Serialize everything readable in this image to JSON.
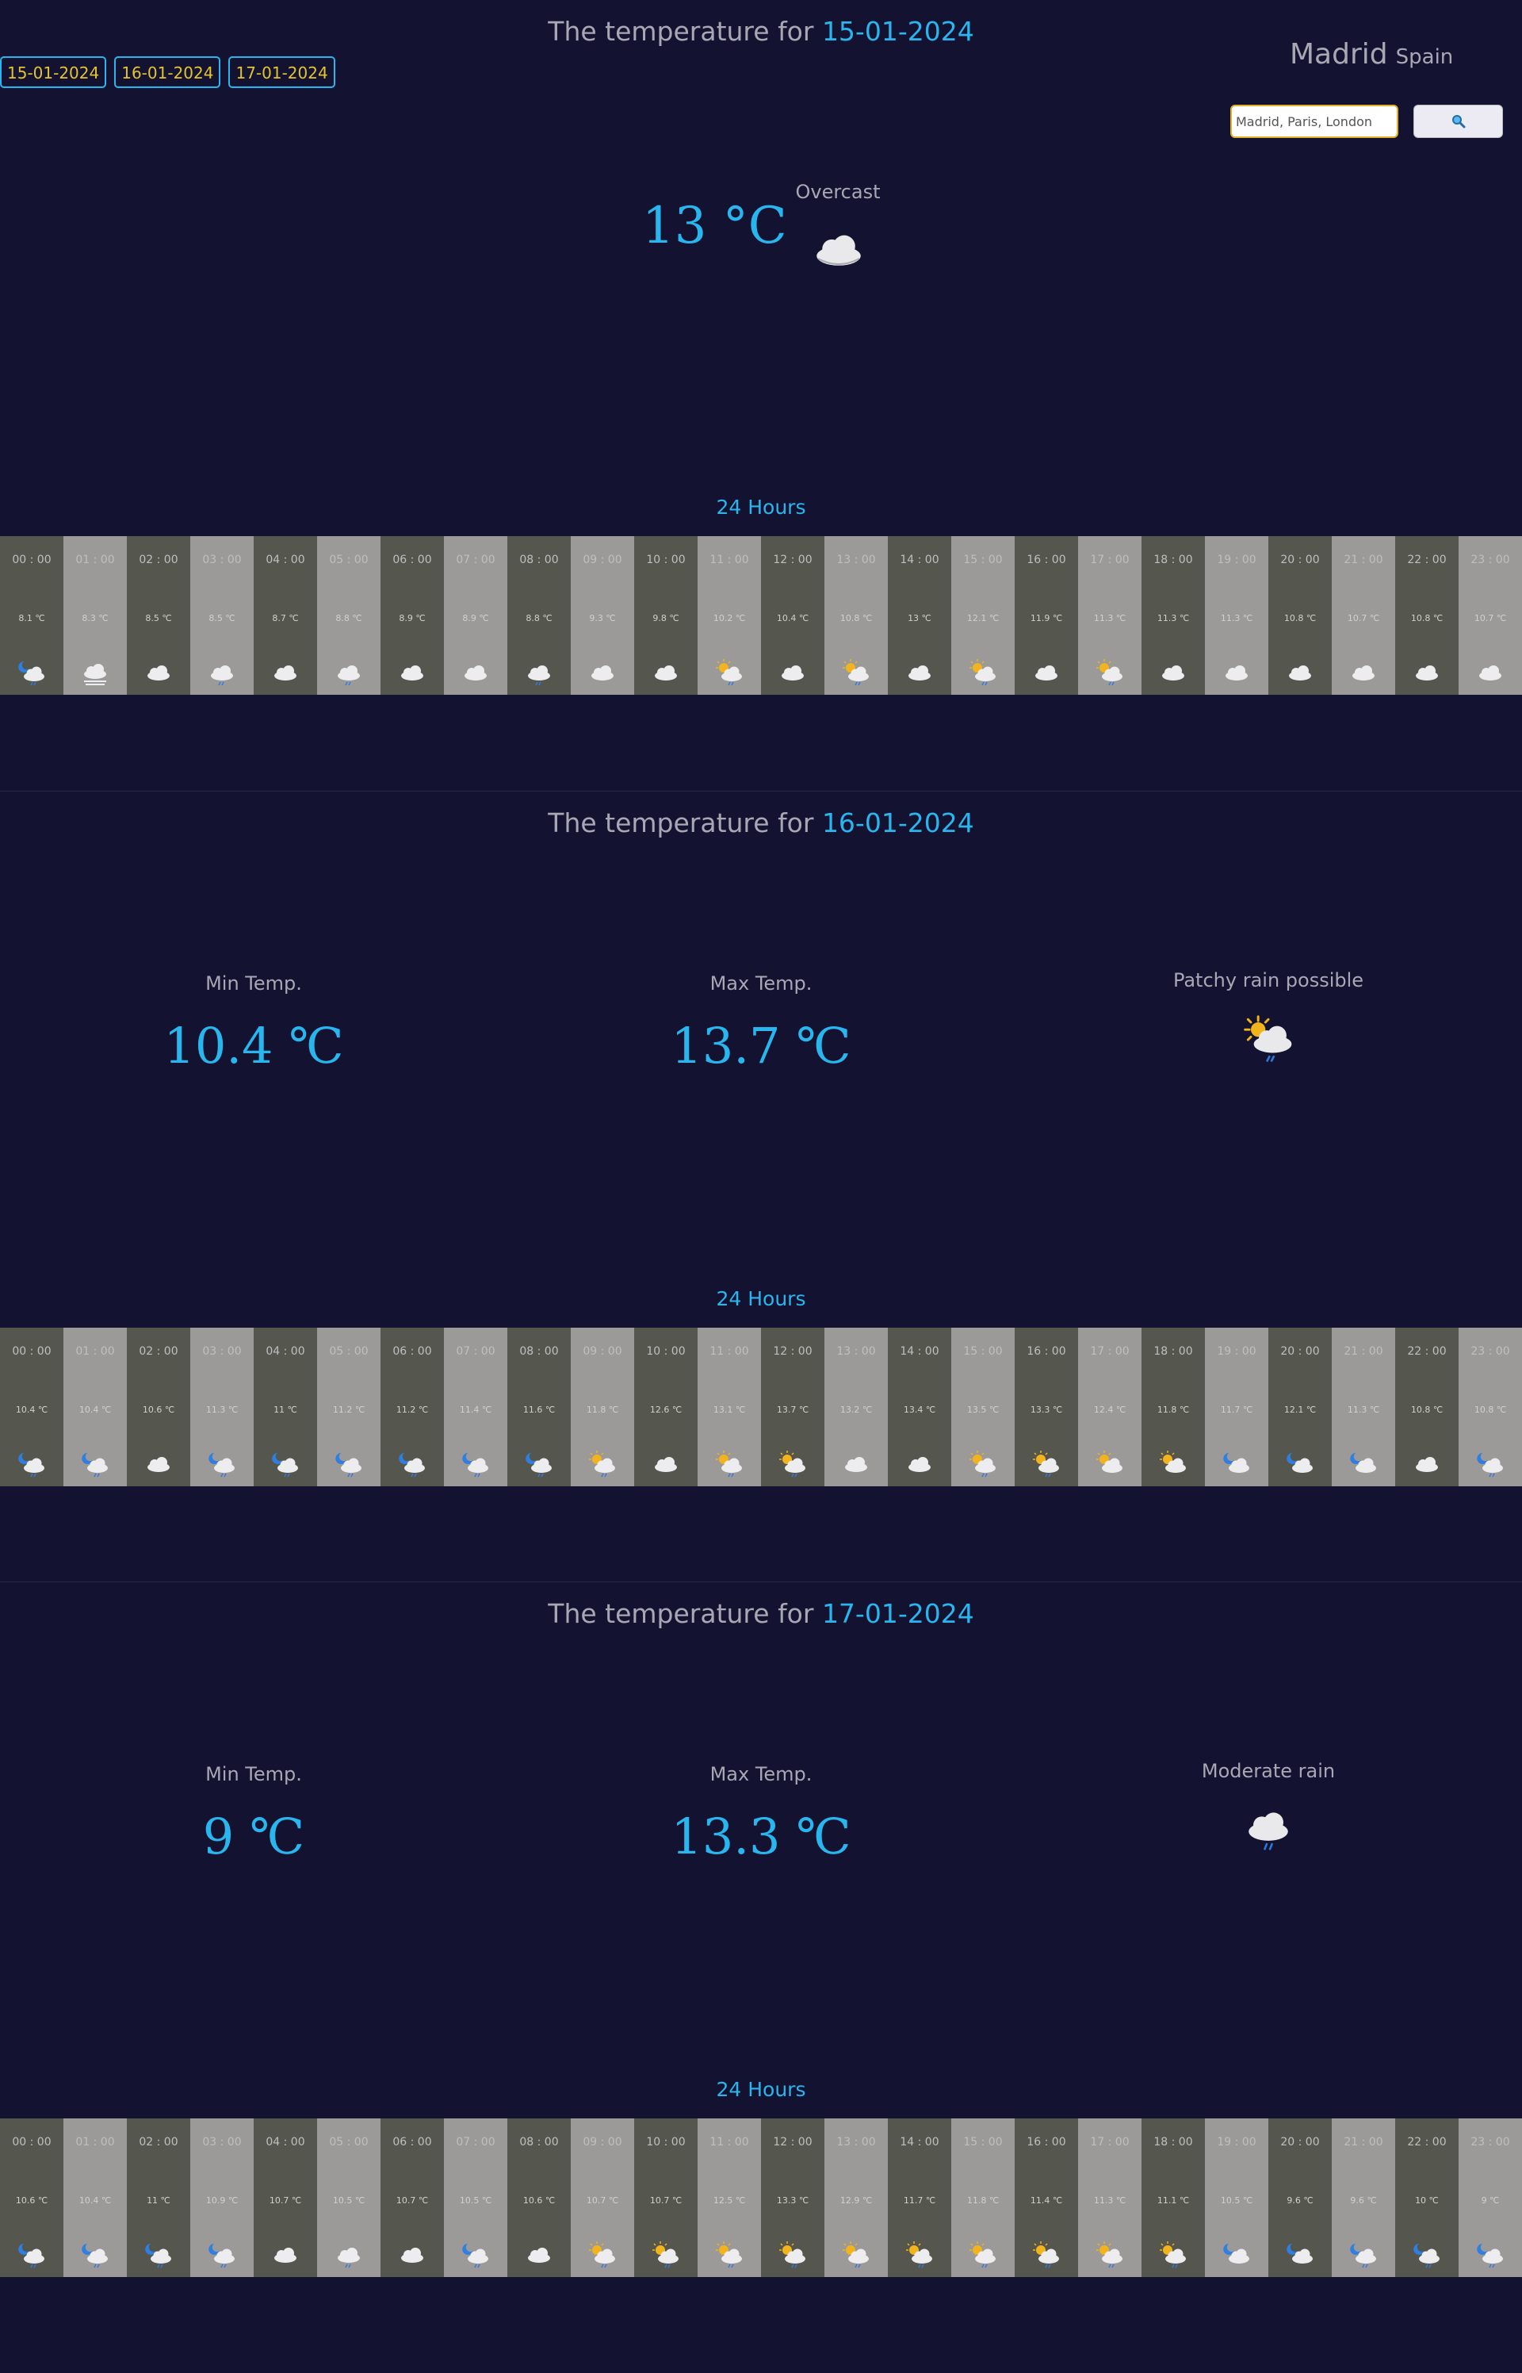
{
  "city": "Madrid",
  "country": "Spain",
  "search": {
    "placeholder": "Madrid, Paris, London"
  },
  "title_prefix": "The temperature for",
  "date_buttons": [
    "15-01-2024",
    "16-01-2024",
    "17-01-2024"
  ],
  "hours_label": "24 Hours",
  "current": {
    "temp": "13 °C",
    "condition": "Overcast",
    "icon": "cloud-icon"
  },
  "days": [
    {
      "date": "15-01-2024",
      "hours": [
        {
          "time": "00 : 00",
          "temp": "8.1 ℃",
          "icon": "night-cloud-rain"
        },
        {
          "time": "01 : 00",
          "temp": "8.3 ℃",
          "icon": "fog"
        },
        {
          "time": "02 : 00",
          "temp": "8.5 ℃",
          "icon": "cloud"
        },
        {
          "time": "03 : 00",
          "temp": "8.5 ℃",
          "icon": "cloud-rain"
        },
        {
          "time": "04 : 00",
          "temp": "8.7 ℃",
          "icon": "cloud"
        },
        {
          "time": "05 : 00",
          "temp": "8.8 ℃",
          "icon": "cloud-rain"
        },
        {
          "time": "06 : 00",
          "temp": "8.9 ℃",
          "icon": "cloud"
        },
        {
          "time": "07 : 00",
          "temp": "8.9 ℃",
          "icon": "cloud"
        },
        {
          "time": "08 : 00",
          "temp": "8.8 ℃",
          "icon": "cloud-rain"
        },
        {
          "time": "09 : 00",
          "temp": "9.3 ℃",
          "icon": "cloud"
        },
        {
          "time": "10 : 00",
          "temp": "9.8 ℃",
          "icon": "cloud"
        },
        {
          "time": "11 : 00",
          "temp": "10.2 ℃",
          "icon": "sun-cloud-rain"
        },
        {
          "time": "12 : 00",
          "temp": "10.4 ℃",
          "icon": "cloud"
        },
        {
          "time": "13 : 00",
          "temp": "10.8 ℃",
          "icon": "sun-cloud-rain"
        },
        {
          "time": "14 : 00",
          "temp": "13 ℃",
          "icon": "cloud"
        },
        {
          "time": "15 : 00",
          "temp": "12.1 ℃",
          "icon": "sun-cloud-rain"
        },
        {
          "time": "16 : 00",
          "temp": "11.9 ℃",
          "icon": "cloud"
        },
        {
          "time": "17 : 00",
          "temp": "11.3 ℃",
          "icon": "sun-cloud-rain"
        },
        {
          "time": "18 : 00",
          "temp": "11.3 ℃",
          "icon": "cloud"
        },
        {
          "time": "19 : 00",
          "temp": "11.3 ℃",
          "icon": "cloud"
        },
        {
          "time": "20 : 00",
          "temp": "10.8 ℃",
          "icon": "cloud"
        },
        {
          "time": "21 : 00",
          "temp": "10.7 ℃",
          "icon": "cloud"
        },
        {
          "time": "22 : 00",
          "temp": "10.8 ℃",
          "icon": "cloud"
        },
        {
          "time": "23 : 00",
          "temp": "10.7 ℃",
          "icon": "cloud"
        }
      ]
    },
    {
      "date": "16-01-2024",
      "min_label": "Min Temp.",
      "min": "10.4 ℃",
      "max_label": "Max Temp.",
      "max": "13.7 ℃",
      "condition": "Patchy rain possible",
      "icon": "sun-cloud-rain",
      "hours": [
        {
          "time": "00 : 00",
          "temp": "10.4 ℃",
          "icon": "night-cloud-rain"
        },
        {
          "time": "01 : 00",
          "temp": "10.4 ℃",
          "icon": "night-cloud-rain"
        },
        {
          "time": "02 : 00",
          "temp": "10.6 ℃",
          "icon": "cloud"
        },
        {
          "time": "03 : 00",
          "temp": "11.3 ℃",
          "icon": "night-cloud-rain"
        },
        {
          "time": "04 : 00",
          "temp": "11 ℃",
          "icon": "night-cloud-rain"
        },
        {
          "time": "05 : 00",
          "temp": "11.2 ℃",
          "icon": "night-cloud-rain"
        },
        {
          "time": "06 : 00",
          "temp": "11.2 ℃",
          "icon": "night-cloud-rain"
        },
        {
          "time": "07 : 00",
          "temp": "11.4 ℃",
          "icon": "night-cloud-rain"
        },
        {
          "time": "08 : 00",
          "temp": "11.6 ℃",
          "icon": "night-cloud-rain"
        },
        {
          "time": "09 : 00",
          "temp": "11.8 ℃",
          "icon": "sun-cloud-rain"
        },
        {
          "time": "10 : 00",
          "temp": "12.6 ℃",
          "icon": "cloud"
        },
        {
          "time": "11 : 00",
          "temp": "13.1 ℃",
          "icon": "sun-cloud-rain"
        },
        {
          "time": "12 : 00",
          "temp": "13.7 ℃",
          "icon": "sun-cloud-rain"
        },
        {
          "time": "13 : 00",
          "temp": "13.2 ℃",
          "icon": "cloud"
        },
        {
          "time": "14 : 00",
          "temp": "13.4 ℃",
          "icon": "cloud"
        },
        {
          "time": "15 : 00",
          "temp": "13.5 ℃",
          "icon": "sun-cloud-rain"
        },
        {
          "time": "16 : 00",
          "temp": "13.3 ℃",
          "icon": "sun-cloud-rain"
        },
        {
          "time": "17 : 00",
          "temp": "12.4 ℃",
          "icon": "sun-cloud"
        },
        {
          "time": "18 : 00",
          "temp": "11.8 ℃",
          "icon": "sun-cloud"
        },
        {
          "time": "19 : 00",
          "temp": "11.7 ℃",
          "icon": "night-cloud"
        },
        {
          "time": "20 : 00",
          "temp": "12.1 ℃",
          "icon": "night-cloud"
        },
        {
          "time": "21 : 00",
          "temp": "11.3 ℃",
          "icon": "night-cloud"
        },
        {
          "time": "22 : 00",
          "temp": "10.8 ℃",
          "icon": "cloud"
        },
        {
          "time": "23 : 00",
          "temp": "10.8 ℃",
          "icon": "night-cloud-rain"
        }
      ]
    },
    {
      "date": "17-01-2024",
      "min_label": "Min Temp.",
      "min": "9 ℃",
      "max_label": "Max Temp.",
      "max": "13.3 ℃",
      "condition": "Moderate rain",
      "icon": "cloud-rain",
      "hours": [
        {
          "time": "00 : 00",
          "temp": "10.6 ℃",
          "icon": "night-cloud-rain"
        },
        {
          "time": "01 : 00",
          "temp": "10.4 ℃",
          "icon": "night-cloud-rain"
        },
        {
          "time": "02 : 00",
          "temp": "11 ℃",
          "icon": "night-cloud-rain"
        },
        {
          "time": "03 : 00",
          "temp": "10.9 ℃",
          "icon": "night-cloud-rain"
        },
        {
          "time": "04 : 00",
          "temp": "10.7 ℃",
          "icon": "cloud"
        },
        {
          "time": "05 : 00",
          "temp": "10.5 ℃",
          "icon": "cloud-rain"
        },
        {
          "time": "06 : 00",
          "temp": "10.7 ℃",
          "icon": "cloud"
        },
        {
          "time": "07 : 00",
          "temp": "10.5 ℃",
          "icon": "night-cloud-rain"
        },
        {
          "time": "08 : 00",
          "temp": "10.6 ℃",
          "icon": "cloud"
        },
        {
          "time": "09 : 00",
          "temp": "10.7 ℃",
          "icon": "sun-cloud-rain"
        },
        {
          "time": "10 : 00",
          "temp": "10.7 ℃",
          "icon": "sun-cloud-rain"
        },
        {
          "time": "11 : 00",
          "temp": "12.5 ℃",
          "icon": "sun-cloud-rain"
        },
        {
          "time": "12 : 00",
          "temp": "13.3 ℃",
          "icon": "sun-cloud-rain"
        },
        {
          "time": "13 : 00",
          "temp": "12.9 ℃",
          "icon": "sun-cloud-rain"
        },
        {
          "time": "14 : 00",
          "temp": "11.7 ℃",
          "icon": "sun-cloud-rain"
        },
        {
          "time": "15 : 00",
          "temp": "11.8 ℃",
          "icon": "sun-cloud-rain"
        },
        {
          "time": "16 : 00",
          "temp": "11.4 ℃",
          "icon": "sun-cloud-rain"
        },
        {
          "time": "17 : 00",
          "temp": "11.3 ℃",
          "icon": "sun-cloud-rain"
        },
        {
          "time": "18 : 00",
          "temp": "11.1 ℃",
          "icon": "sun-cloud-rain"
        },
        {
          "time": "19 : 00",
          "temp": "10.5 ℃",
          "icon": "night-cloud"
        },
        {
          "time": "20 : 00",
          "temp": "9.6 ℃",
          "icon": "night-cloud"
        },
        {
          "time": "21 : 00",
          "temp": "9.6 ℃",
          "icon": "night-cloud-rain"
        },
        {
          "time": "22 : 00",
          "temp": "10 ℃",
          "icon": "night-cloud-rain"
        },
        {
          "time": "23 : 00",
          "temp": "9 ℃",
          "icon": "night-cloud-rain"
        }
      ]
    }
  ],
  "colors": {
    "background": "#131230",
    "accent": "#29b6ee",
    "button_text": "#e3c430",
    "text": "#a8a8b4",
    "cell_dark": "#55574f",
    "cell_light": "#9c9999"
  }
}
